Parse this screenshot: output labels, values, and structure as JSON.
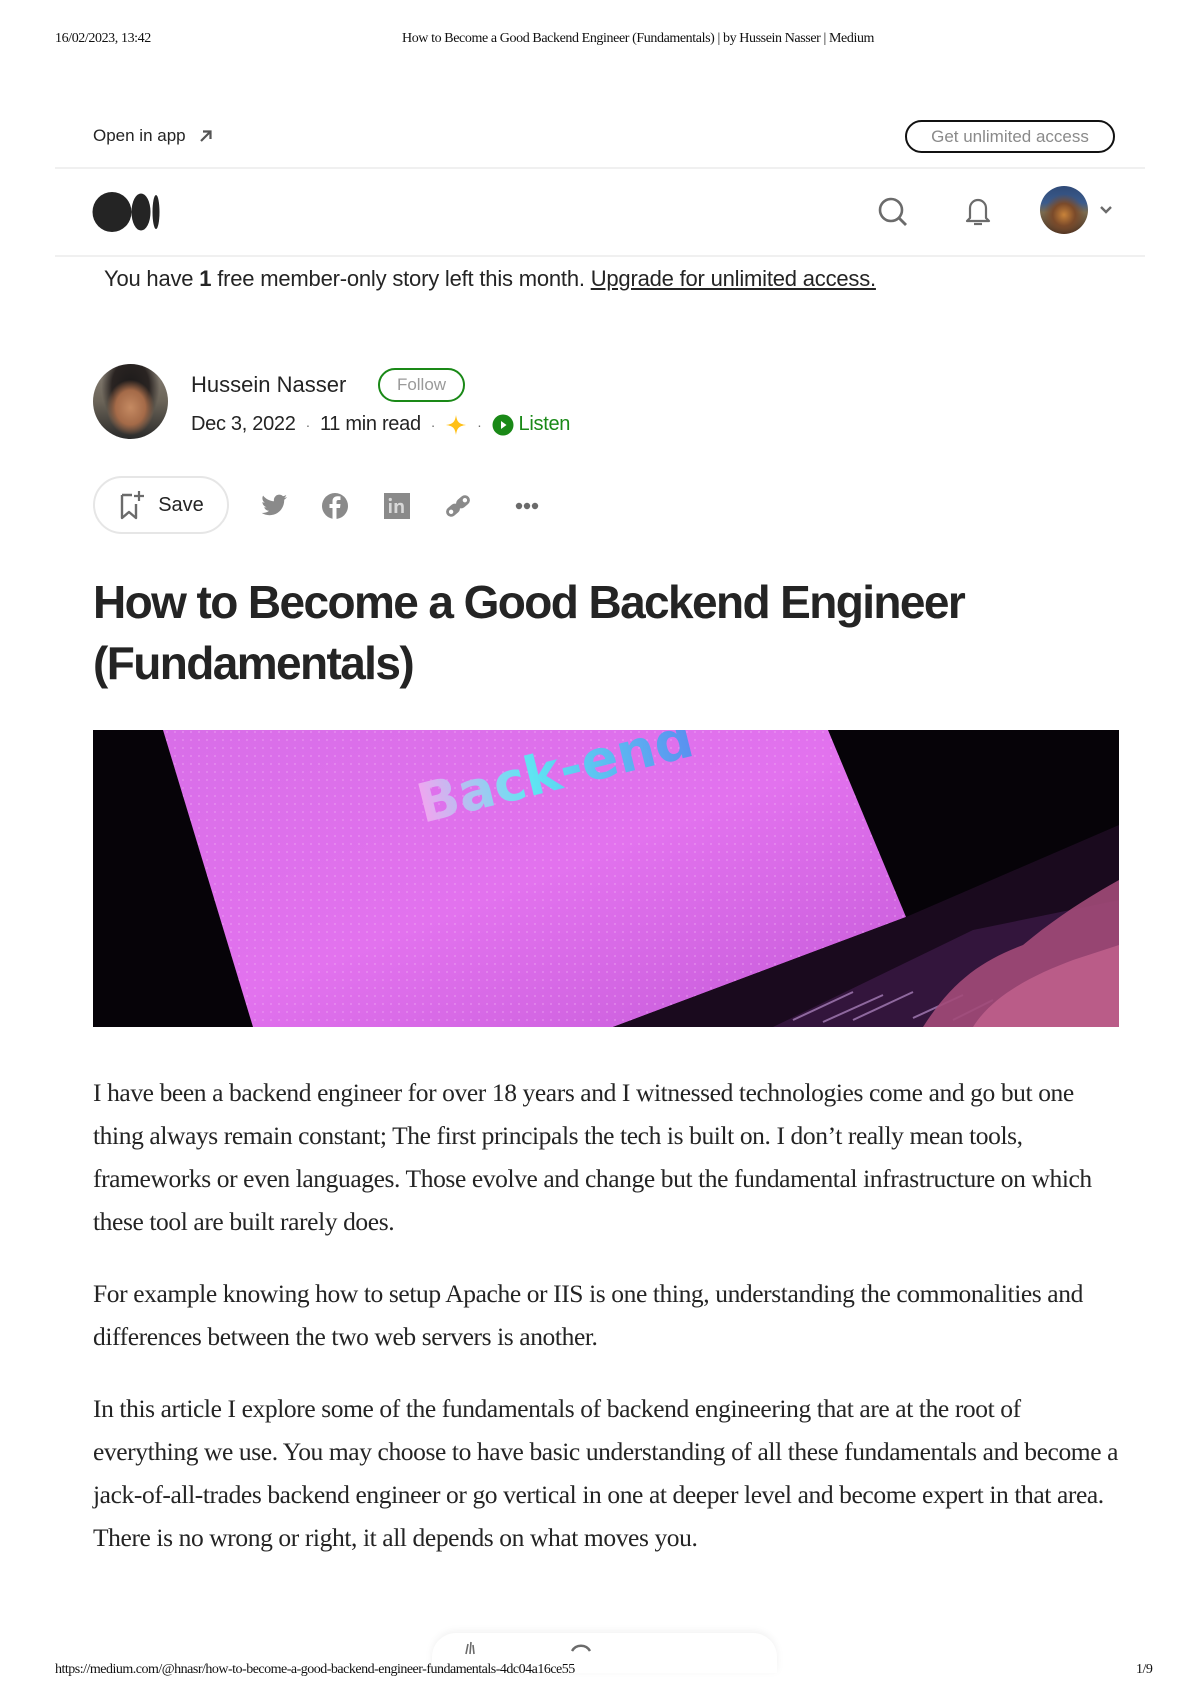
{
  "print_header": {
    "datetime": "16/02/2023, 13:42",
    "doc_title": "How to Become a Good Backend Engineer (Fundamentals) | by Hussein Nasser | Medium"
  },
  "top_bar": {
    "open_in_app": "Open in app",
    "open_in_app_icon": "arrow-up-right-icon",
    "get_unlimited_access": "Get unlimited access"
  },
  "nav": {
    "logo": "medium-logo",
    "search_icon": "search-icon",
    "notifications_icon": "bell-icon",
    "avatar": "user-avatar",
    "menu_icon": "chevron-down-icon"
  },
  "notice": {
    "prefix": "You have ",
    "count": "1",
    "suffix": " free member-only story left this month. ",
    "link": "Upgrade for unlimited access."
  },
  "author": {
    "name": "Hussein Nasser",
    "follow_label": "Follow",
    "date": "Dec 3, 2022",
    "read_time": "11 min read",
    "separator": "·",
    "member_badge": "star-icon",
    "listen_label": "Listen"
  },
  "actions": {
    "save_label": "Save",
    "share": [
      "twitter-icon",
      "facebook-icon",
      "linkedin-icon",
      "link-icon",
      "more-icon"
    ]
  },
  "article": {
    "title": "How to Become a Good Backend Engineer (Fundamentals)",
    "hero_text": "Back-end",
    "paragraphs": [
      "I have been a backend engineer for over 18 years and I witnessed technologies come and go but one thing always remain constant; The first principals the tech is built on. I don’t really mean tools, frameworks or even languages. Those evolve and change but the fundamental infrastructure on which these tool are built rarely does.",
      "For example knowing how to setup Apache or IIS is one thing, understanding the commonalities and differences between the two web servers is another.",
      "In this article I explore some of the fundamentals of backend engineering that are at the root of everything we use. You may choose to have basic understanding of all these fundamentals and become a jack-of-all-trades backend engineer or go vertical in one at deeper level and become expert in that area. There is no wrong or right, it all depends on what moves you."
    ]
  },
  "colors": {
    "accent_green": "#1a8917",
    "text": "#242424",
    "muted": "#6b6b6b",
    "star": "#ffc017"
  },
  "print_footer": {
    "url": "https://medium.com/@hnasr/how-to-become-a-good-backend-engineer-fundamentals-4dc04a16ce55",
    "page": "1/9"
  }
}
